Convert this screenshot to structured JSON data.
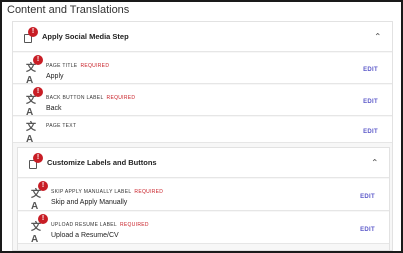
{
  "panel": {
    "title": "Content and Translations"
  },
  "section1": {
    "title": "Apply Social Media Step",
    "rows": [
      {
        "label": "PAGE TITLE",
        "required": "REQUIRED",
        "value": "Apply",
        "edit": "EDIT"
      },
      {
        "label": "BACK BUTTON LABEL",
        "required": "REQUIRED",
        "value": "Back",
        "edit": "EDIT"
      },
      {
        "label": "PAGE TEXT",
        "required": "",
        "value": "",
        "edit": "EDIT"
      }
    ]
  },
  "section2": {
    "title": "Customize Labels and Buttons",
    "rows": [
      {
        "label": "SKIP APPLY MANUALLY LABEL",
        "required": "REQUIRED",
        "value": "Skip and Apply Manually",
        "edit": "EDIT"
      },
      {
        "label": "UPLOAD RESUME LABEL",
        "required": "REQUIRED",
        "value": "Upload a Resume/CV",
        "edit": "EDIT"
      }
    ]
  },
  "badge_text": "!",
  "colors": {
    "badge": "#c81d25",
    "edit_link": "#5a57c9",
    "required": "#c81d25"
  },
  "icons": {
    "section": "document-icon",
    "row": "translate-icon",
    "collapse": "chevron-up-icon"
  }
}
